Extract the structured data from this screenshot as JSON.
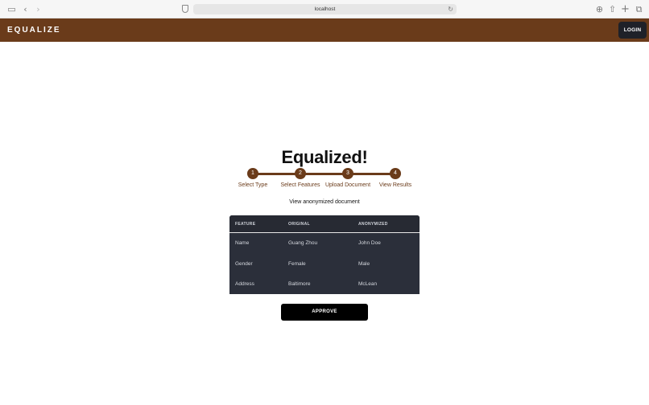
{
  "browser": {
    "url": "localhost",
    "icons": [
      "sidebar-icon",
      "back-icon",
      "forward-icon",
      "reader-icon",
      "reload-icon",
      "download-icon",
      "share-icon",
      "new-tab-icon",
      "tabs-overview-icon"
    ]
  },
  "header": {
    "logo": "EQUALIZE",
    "login_label": "LOGIN",
    "brand_color": "#6a3b1a"
  },
  "main": {
    "title": "Equalized!",
    "subtitle": "View anonymized document",
    "steps": [
      {
        "number": "1",
        "label": "Select Type"
      },
      {
        "number": "2",
        "label": "Select Features"
      },
      {
        "number": "3",
        "label": "Upload Document"
      },
      {
        "number": "4",
        "label": "View Results"
      }
    ],
    "table": {
      "headers": [
        "FEATURE",
        "ORIGINAL",
        "ANONYMIZED"
      ],
      "rows": [
        [
          "Name",
          "Guang Zhou",
          "John Doe"
        ],
        [
          "Gender",
          "Female",
          "Male"
        ],
        [
          "Address",
          "Baltimore",
          "McLean"
        ]
      ]
    },
    "approve_label": "APPROVE"
  }
}
